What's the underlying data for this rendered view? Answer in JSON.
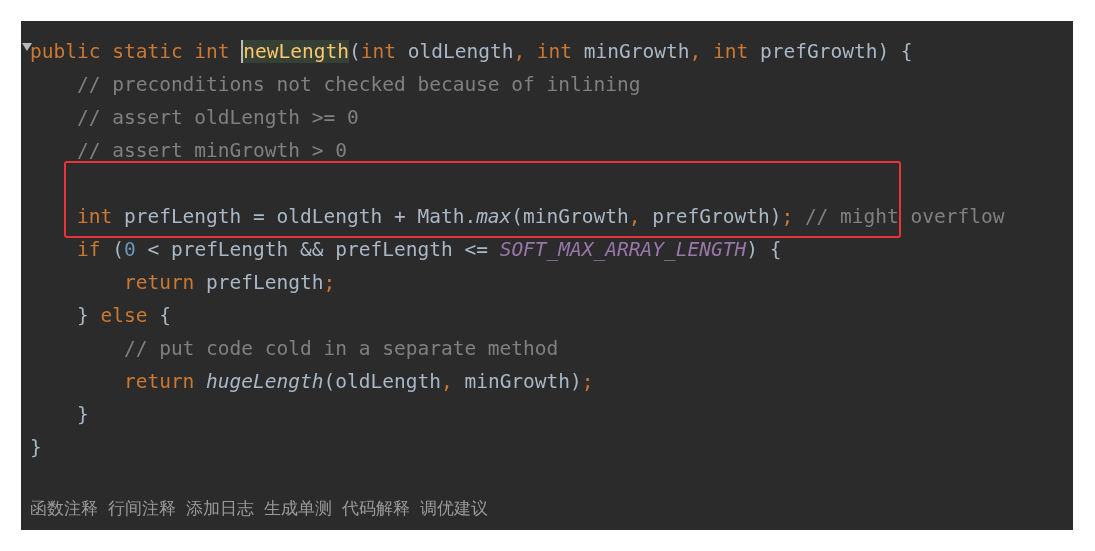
{
  "code_lines": [
    {
      "kind": "code",
      "boxed": false,
      "tokens": [
        {
          "kind": "keyword",
          "text": "public static int "
        },
        {
          "kind": "method",
          "text": "newLength",
          "highlighted": true
        },
        {
          "kind": "punct",
          "text": "("
        },
        {
          "kind": "keyword",
          "text": "int "
        },
        {
          "kind": "ident",
          "text": "oldLength"
        },
        {
          "kind": "keyword",
          "text": ", int "
        },
        {
          "kind": "ident",
          "text": "minGrowth"
        },
        {
          "kind": "keyword",
          "text": ", int "
        },
        {
          "kind": "ident",
          "text": "prefGrowth"
        },
        {
          "kind": "punct",
          "text": ") {"
        }
      ]
    },
    {
      "kind": "code",
      "boxed": false,
      "tokens": [
        {
          "kind": "comment",
          "text": "    // preconditions not checked because of inlining"
        }
      ]
    },
    {
      "kind": "code",
      "boxed": false,
      "tokens": [
        {
          "kind": "comment",
          "text": "    // assert oldLength >= 0"
        }
      ]
    },
    {
      "kind": "code",
      "boxed": false,
      "tokens": [
        {
          "kind": "comment",
          "text": "    // assert minGrowth > 0"
        }
      ]
    },
    {
      "kind": "blank",
      "boxed": true
    },
    {
      "kind": "code",
      "boxed": true,
      "tokens": [
        {
          "kind": "keyword",
          "text": "    int "
        },
        {
          "kind": "ident",
          "text": "prefLength = oldLength + Math."
        },
        {
          "kind": "static",
          "text": "max"
        },
        {
          "kind": "ident",
          "text": "(minGrowth"
        },
        {
          "kind": "keyword",
          "text": ", "
        },
        {
          "kind": "ident",
          "text": "prefGrowth)"
        },
        {
          "kind": "keyword",
          "text": "; "
        },
        {
          "kind": "comment",
          "text": "// might overflow"
        }
      ]
    },
    {
      "kind": "code",
      "boxed": false,
      "tokens": [
        {
          "kind": "keyword",
          "text": "    if "
        },
        {
          "kind": "ident",
          "text": "("
        },
        {
          "kind": "number",
          "text": "0"
        },
        {
          "kind": "ident",
          "text": " < prefLength && prefLength <= "
        },
        {
          "kind": "constant",
          "text": "SOFT_MAX_ARRAY_LENGTH"
        },
        {
          "kind": "ident",
          "text": ") {"
        }
      ]
    },
    {
      "kind": "code",
      "boxed": false,
      "tokens": [
        {
          "kind": "keyword",
          "text": "        return "
        },
        {
          "kind": "ident",
          "text": "prefLength"
        },
        {
          "kind": "keyword",
          "text": ";"
        }
      ]
    },
    {
      "kind": "code",
      "boxed": false,
      "tokens": [
        {
          "kind": "ident",
          "text": "    } "
        },
        {
          "kind": "keyword",
          "text": "else "
        },
        {
          "kind": "ident",
          "text": "{"
        }
      ]
    },
    {
      "kind": "code",
      "boxed": false,
      "tokens": [
        {
          "kind": "comment",
          "text": "        // put code cold in a separate method"
        }
      ]
    },
    {
      "kind": "code",
      "boxed": false,
      "tokens": [
        {
          "kind": "keyword",
          "text": "        return "
        },
        {
          "kind": "static",
          "text": "hugeLength"
        },
        {
          "kind": "ident",
          "text": "(oldLength"
        },
        {
          "kind": "keyword",
          "text": ", "
        },
        {
          "kind": "ident",
          "text": "minGrowth)"
        },
        {
          "kind": "keyword",
          "text": ";"
        }
      ]
    },
    {
      "kind": "code",
      "boxed": false,
      "tokens": [
        {
          "kind": "ident",
          "text": "    }"
        }
      ]
    },
    {
      "kind": "code",
      "boxed": false,
      "tokens": [
        {
          "kind": "ident",
          "text": "}"
        }
      ]
    }
  ],
  "code_lens": [
    "函数注释",
    "行间注释",
    "添加日志",
    "生成单测",
    "代码解释",
    "调优建议"
  ]
}
